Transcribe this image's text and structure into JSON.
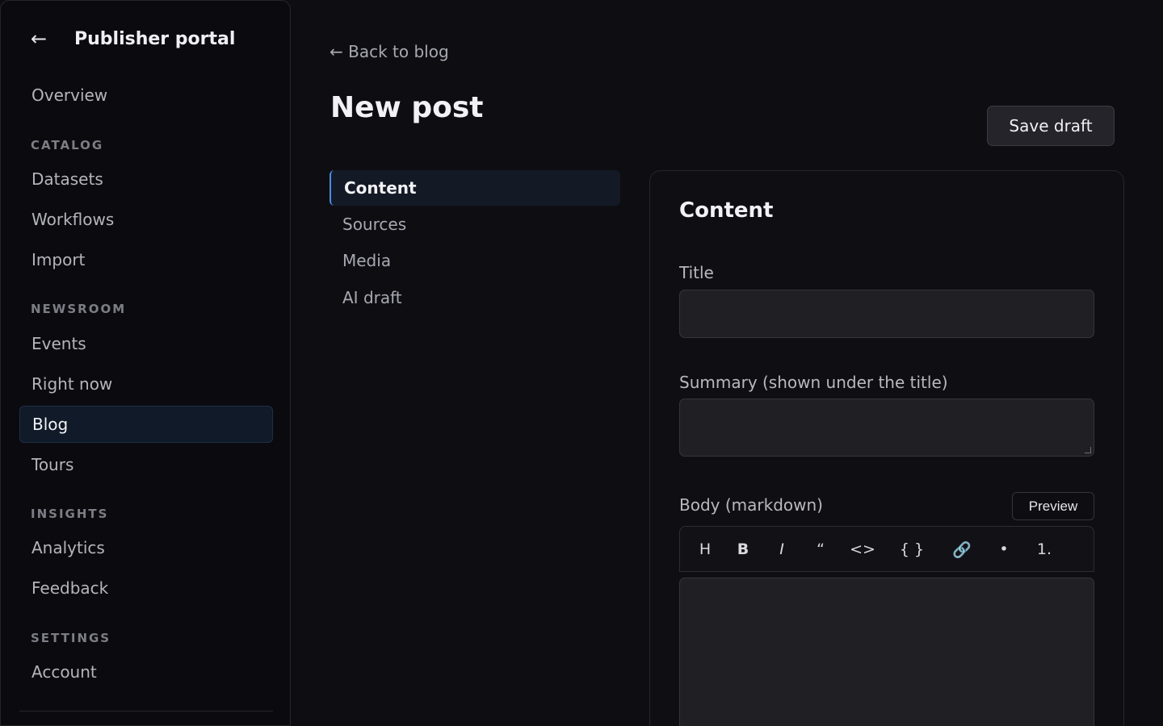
{
  "sidebar": {
    "back_icon": "←",
    "title": "Publisher portal",
    "overview": "Overview",
    "sections": {
      "catalog": "CATALOG",
      "newsroom": "NEWSROOM",
      "insights": "INSIGHTS",
      "settings": "SETTINGS"
    },
    "items": {
      "datasets": "Datasets",
      "workflows": "Workflows",
      "import": "Import",
      "events": "Events",
      "right_now": "Right now",
      "blog": "Blog",
      "tours": "Tours",
      "analytics": "Analytics",
      "feedback": "Feedback",
      "account": "Account"
    },
    "active": "Blog"
  },
  "main": {
    "back_link": "← Back to blog",
    "title": "New post",
    "save_label": "Save draft",
    "tabs": [
      "Content",
      "Sources",
      "Media",
      "AI draft"
    ],
    "active_tab": "Content"
  },
  "card": {
    "title": "Content",
    "title_label": "Title",
    "title_value": "",
    "summary_label": "Summary (shown under the title)",
    "summary_value": "",
    "body_label": "Body (markdown)",
    "preview_label": "Preview",
    "body_value": "",
    "toolbar": {
      "heading": "H",
      "bold": "B",
      "italic": "I",
      "quote": "“",
      "inline_code": "<>",
      "code_block": "{ }",
      "link": "🔗",
      "bullet_list": "•",
      "numbered_list": "1."
    }
  },
  "colors": {
    "background": "#0e0e12",
    "accent": "#4a8fe0",
    "active_bg": "#101a28"
  }
}
